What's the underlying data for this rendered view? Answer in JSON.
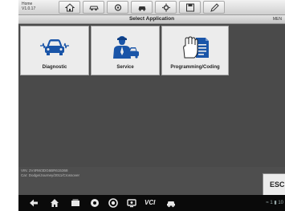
{
  "toolbar": {
    "vehicle_info_line1": "Home",
    "vehicle_info_line2": "V1.0.17",
    "buttons": [
      {
        "icon": "home-icon"
      },
      {
        "icon": "vehicle-icon"
      },
      {
        "icon": "settings-icon"
      },
      {
        "icon": "car-icon"
      },
      {
        "icon": "gear-icon"
      },
      {
        "icon": "save-icon"
      },
      {
        "icon": "edit-icon"
      }
    ]
  },
  "title_bar": {
    "title": "Select Application",
    "status": "MEN"
  },
  "applications": [
    {
      "label": "Diagnostic",
      "icon": "diagnostic-car-icon"
    },
    {
      "label": "Service",
      "icon": "service-technician-icon"
    },
    {
      "label": "Programming/Coding",
      "icon": "programming-hand-icon"
    }
  ],
  "footer_info": {
    "line1": "VIN: 2V4RW3DG6BR615368",
    "line2": "Car: Dodge/Journey/2011/Crossover"
  },
  "esc_label": "ESC",
  "navbar": {
    "vci_label": "VCI",
    "tray_text": "≈ 1 ▮ 10"
  },
  "colors": {
    "background": "#4a4a4a",
    "tile": "#ececec",
    "icon_blue": "#1a55a8",
    "navbar": "#0a0a0a"
  }
}
